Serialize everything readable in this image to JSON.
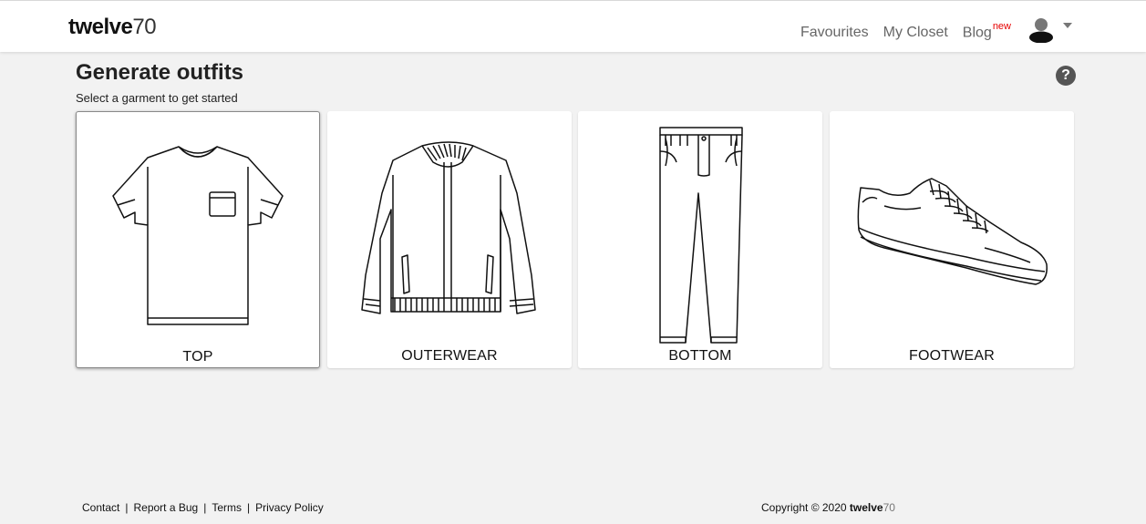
{
  "header": {
    "logo_bold": "twelve",
    "logo_thin": "70",
    "nav": {
      "favourites": "Favourites",
      "my_closet": "My Closet",
      "blog": "Blog",
      "blog_badge": "new"
    }
  },
  "main": {
    "title": "Generate outfits",
    "subtitle": "Select a garment to get started",
    "help_icon": "?",
    "cards": [
      {
        "label": "TOP",
        "icon": "tshirt-icon",
        "selected": true
      },
      {
        "label": "OUTERWEAR",
        "icon": "jacket-icon",
        "selected": false
      },
      {
        "label": "BOTTOM",
        "icon": "pants-icon",
        "selected": false
      },
      {
        "label": "FOOTWEAR",
        "icon": "sneaker-icon",
        "selected": false
      }
    ]
  },
  "footer": {
    "links": [
      "Contact",
      "Report a Bug",
      "Terms",
      "Privacy Policy"
    ],
    "separator": "|",
    "copyright_text": "Copyright © 2020 ",
    "copyright_brand_bold": "twelve",
    "copyright_brand_thin": "70"
  },
  "colors": {
    "background": "#f2f2f2",
    "card": "#ffffff",
    "badge_new": "#e60000",
    "nav_text": "#666666"
  }
}
